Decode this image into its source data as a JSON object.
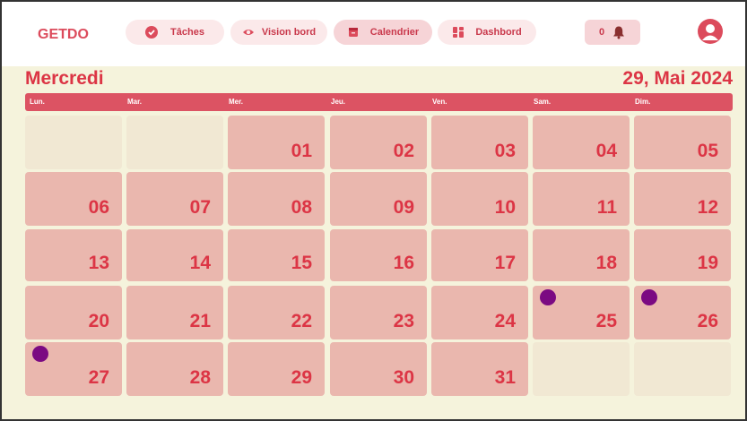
{
  "app": {
    "brand": "GETDO"
  },
  "nav": {
    "items": [
      {
        "label": "Tâches",
        "icon": "check-circle-icon"
      },
      {
        "label": "Vision bord",
        "icon": "eye-icon"
      },
      {
        "label": "Calendrier",
        "icon": "calendar-icon",
        "active": true
      },
      {
        "label": "Dashbord",
        "icon": "dashboard-icon"
      }
    ]
  },
  "notifications": {
    "count": "0",
    "icon": "bell-icon"
  },
  "user": {
    "icon": "user-avatar-icon"
  },
  "header": {
    "day_name": "Mercredi",
    "date": "29, Mai 2024"
  },
  "weekdays": [
    "Lun.",
    "Mar.",
    "Mer.",
    "Jeu.",
    "Ven.",
    "Sam.",
    "Dim."
  ],
  "weeks": [
    [
      "",
      "",
      "01",
      "02",
      "03",
      "04",
      "05"
    ],
    [
      "06",
      "07",
      "08",
      "09",
      "10",
      "11",
      "12"
    ],
    [
      "13",
      "14",
      "15",
      "16",
      "17",
      "18",
      "19"
    ],
    [
      "20",
      "21",
      "22",
      "23",
      "24",
      "25",
      "26"
    ],
    [
      "27",
      "28",
      "29",
      "30",
      "31",
      "",
      ""
    ]
  ],
  "event_days": [
    "25",
    "26",
    "27"
  ],
  "colors": {
    "accent": "#dc3545",
    "event_dot": "#7b0a82",
    "cell": "#eab7ae",
    "background": "#f5f3dc"
  }
}
